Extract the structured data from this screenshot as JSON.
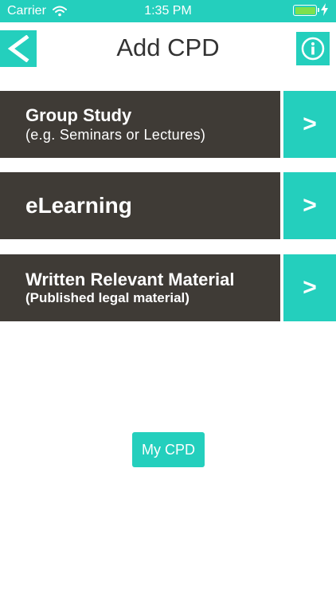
{
  "status_bar": {
    "carrier": "Carrier",
    "time": "1:35 PM",
    "battery_level": 1.0,
    "bar_color": "#24cfbd",
    "battery_color": "#7ee04d"
  },
  "header": {
    "title": "Add CPD",
    "back_icon": "back-chevron-icon",
    "info_icon": "info-icon"
  },
  "rows": [
    {
      "title": "Group Study",
      "subtitle": "(e.g. Seminars or Lectures)",
      "arrow": ">"
    },
    {
      "title": "eLearning",
      "arrow": ">"
    },
    {
      "title": "Written Relevant Material",
      "subtitle": "(Published legal material)",
      "arrow": ">"
    }
  ],
  "my_cpd_button": "My CPD",
  "colors": {
    "accent": "#24cfbd",
    "panel": "#3f3b36",
    "title_text": "#333333"
  }
}
